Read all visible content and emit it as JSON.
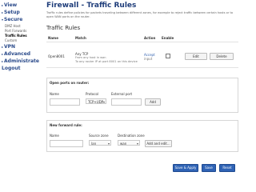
{
  "sidebar": {
    "items": [
      {
        "label": "View"
      },
      {
        "label": "Setup"
      },
      {
        "label": "Secure"
      },
      {
        "label": "VPN"
      },
      {
        "label": "Advanced"
      },
      {
        "label": "Administrate"
      }
    ],
    "sub_items": [
      "DMZ Host",
      "Port Forwards",
      "Traffic Rules",
      "Custom"
    ],
    "logout": "Logout"
  },
  "page": {
    "title": "Firewall - Traffic Rules",
    "description": "Traffic rules define policies for packets traveling between different zones, for example to reject traffic between certain hosts or to open WAN ports on the router.",
    "section_title": "Traffic Rules"
  },
  "rules_table": {
    "headers": [
      "Name",
      "Match",
      "Action",
      "Enable"
    ],
    "rows": [
      {
        "name": "Open8001",
        "match_line1": "Any TCP",
        "match_line2": "From any host in wan",
        "match_line3": "To any router IP at port 8001 on this device",
        "action_line1": "Accept",
        "action_line2": "input",
        "edit_label": "Edit",
        "delete_label": "Delete"
      }
    ]
  },
  "open_ports": {
    "title": "Open ports on router:",
    "headers": [
      "Name",
      "Protocol",
      "External port"
    ],
    "protocol_value": "TCP+UDP",
    "add_label": "Add"
  },
  "forward_rule": {
    "title": "New forward rule:",
    "headers": [
      "Name",
      "Source zone",
      "Destination zone"
    ],
    "source_value": "lan",
    "destination_value": "wan",
    "add_label": "Add and edit..."
  },
  "footer": {
    "save_apply": "Save & Apply",
    "save": "Save",
    "reset": "Reset"
  }
}
